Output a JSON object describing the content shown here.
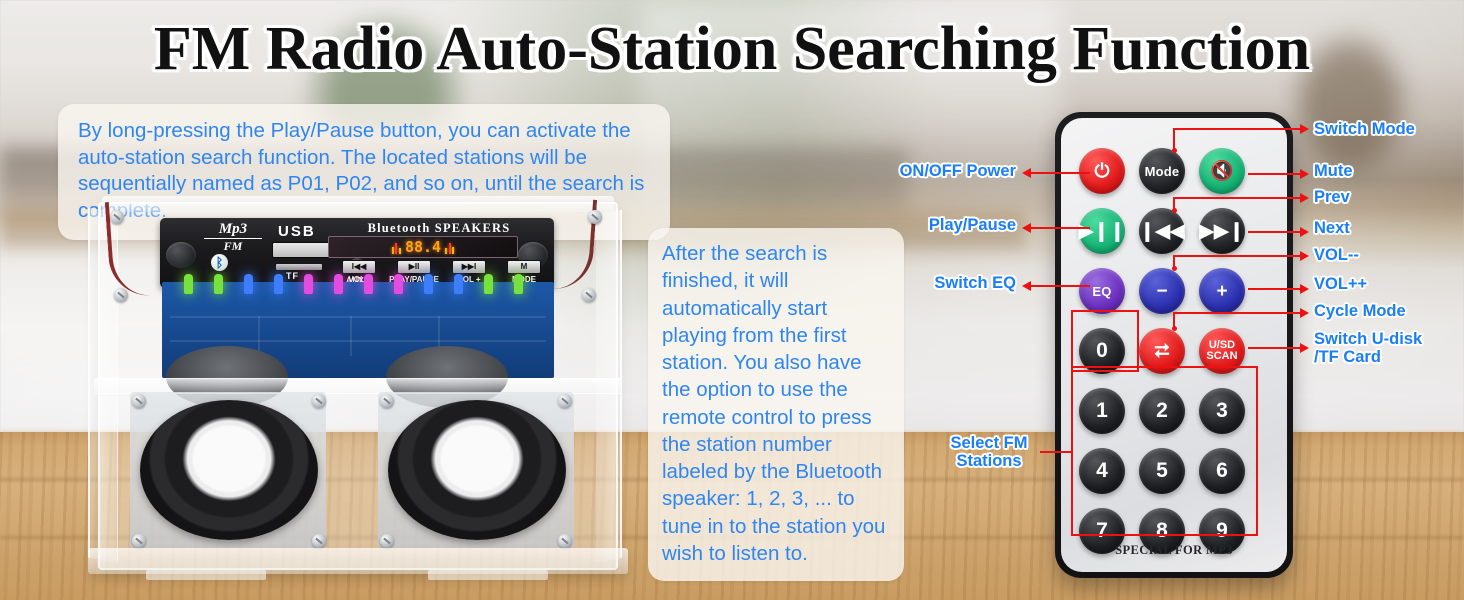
{
  "title": "FM Radio Auto-Station Searching Function",
  "callouts": {
    "top": "By long-pressing the Play/Pause button, you can activate the auto-station search function. The located stations will be sequentially named as P01, P02, and so on, until the search is complete.",
    "middle": "After the search is finished, it will automatically start playing from the first station. You also have the option to use the remote control to press the station number labeled by the Bluetooth speaker:\n1, 2, 3, ... to tune in to the station you wish to listen to."
  },
  "product": {
    "brand_mp3": "Mp3",
    "brand_fm": "FM",
    "usb_label": "USB",
    "tf_label": "TF",
    "aux_label": "AUX",
    "bluetooth_speakers_label": "Bluetooth SPEAKERS",
    "display_frequency": "88.4",
    "buttons": [
      {
        "glyph": "I◀◀",
        "caption": "VOL -"
      },
      {
        "glyph": "▶II",
        "caption": "PLAY/PAUSE"
      },
      {
        "glyph": "▶▶I",
        "caption": "VOL +"
      },
      {
        "glyph": "M",
        "caption": "MODE"
      }
    ]
  },
  "remote": {
    "footer": "SPECIAL FOR MP3",
    "buttons": {
      "power": "⏻",
      "mode": "Mode",
      "mute": "🔇",
      "play_pause": "▶❙❙",
      "prev": "❙◀◀",
      "next": "▶▶❙",
      "eq": "EQ",
      "vol_down": "−",
      "vol_up": "+",
      "cycle": "⮂",
      "usd_scan_line1": "U/SD",
      "usd_scan_line2": "SCAN"
    },
    "numbers": [
      "0",
      "1",
      "2",
      "3",
      "4",
      "5",
      "6",
      "7",
      "8",
      "9"
    ]
  },
  "annotations": {
    "left": [
      {
        "key": "power",
        "text": "ON/OFF Power"
      },
      {
        "key": "play_pause",
        "text": "Play/Pause"
      },
      {
        "key": "eq",
        "text": "Switch EQ"
      },
      {
        "key": "select_fm",
        "text": "Select FM\nStations"
      }
    ],
    "right": [
      {
        "key": "mode",
        "text": "Switch Mode"
      },
      {
        "key": "mute",
        "text": "Mute"
      },
      {
        "key": "prev",
        "text": "Prev"
      },
      {
        "key": "next",
        "text": "Next"
      },
      {
        "key": "vol_down",
        "text": "VOL--"
      },
      {
        "key": "vol_up",
        "text": "VOL++"
      },
      {
        "key": "cycle",
        "text": "Cycle Mode"
      },
      {
        "key": "usd",
        "text": "Switch U-disk\n/TF Card"
      }
    ]
  },
  "colors": {
    "label_blue": "#1a7efb",
    "annotation_red": "#ee1111",
    "callout_text_blue": "#2f86f0",
    "power_red": "#e01919",
    "play_green": "#15b374",
    "eq_purple": "#6a2fbe",
    "vol_blue": "#2b2fae",
    "cycle_red": "#e01919"
  }
}
